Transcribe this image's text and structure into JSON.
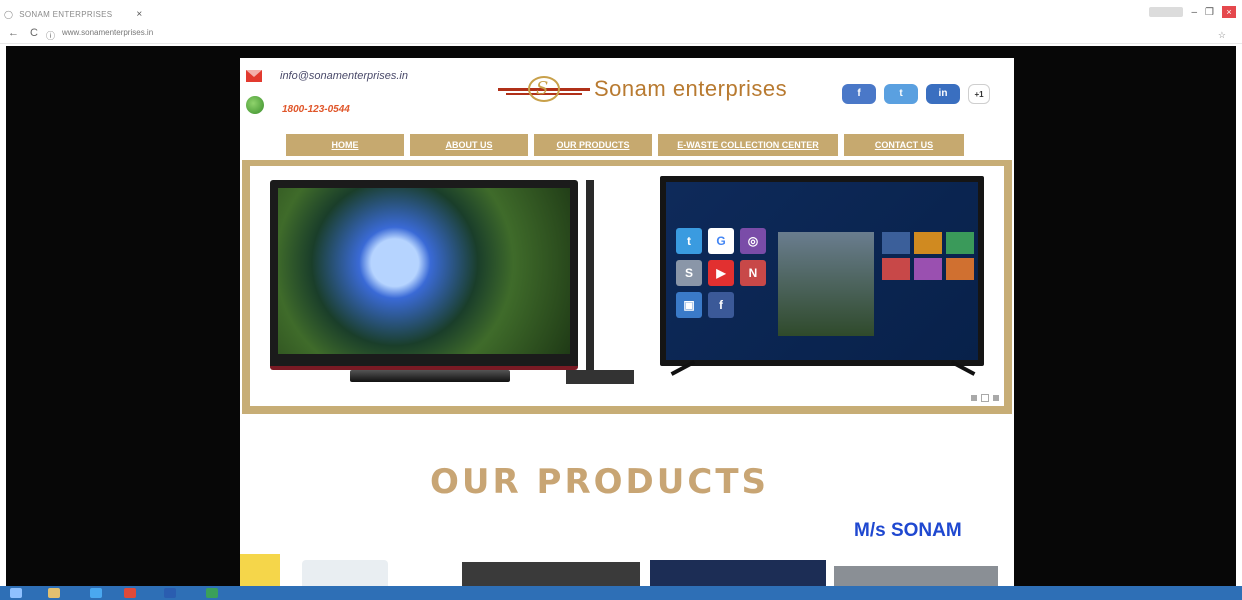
{
  "browser": {
    "tab_title": "SONAM ENTERPRISES",
    "tab_close": "×",
    "url": "www.sonamenterprises.in",
    "back_icon": "back-arrow-icon",
    "reload_icon": "reload-icon",
    "window_controls": {
      "minimize": "–",
      "restore": "❐",
      "close": "×"
    },
    "star_icon": "bookmark-star-icon"
  },
  "header": {
    "email": "info@sonamenterprises.in",
    "phone": "1800-123-0544",
    "logo_text": "Sonam enterprises",
    "social": [
      {
        "name": "facebook",
        "label": "f"
      },
      {
        "name": "twitter",
        "label": "t"
      },
      {
        "name": "linkedin",
        "label": "in"
      },
      {
        "name": "google-plus",
        "label": "+1"
      }
    ]
  },
  "nav": {
    "items": [
      {
        "label": "HOME"
      },
      {
        "label": "ABOUT US"
      },
      {
        "label": "OUR PRODUCTS"
      },
      {
        "label": "E-WASTE COLLECTION CENTER"
      },
      {
        "label": "CONTACT US"
      }
    ]
  },
  "slider": {
    "tv_apps": [
      "G",
      "f"
    ],
    "dots_count": 3
  },
  "products": {
    "title": "OUR PRODUCTS",
    "company": "M/s SONAM"
  },
  "colors": {
    "accent_gold": "#c6a96f",
    "title_gold": "#c8a574",
    "blue_text": "#1f48d0",
    "phone_orange": "#e0562a"
  }
}
